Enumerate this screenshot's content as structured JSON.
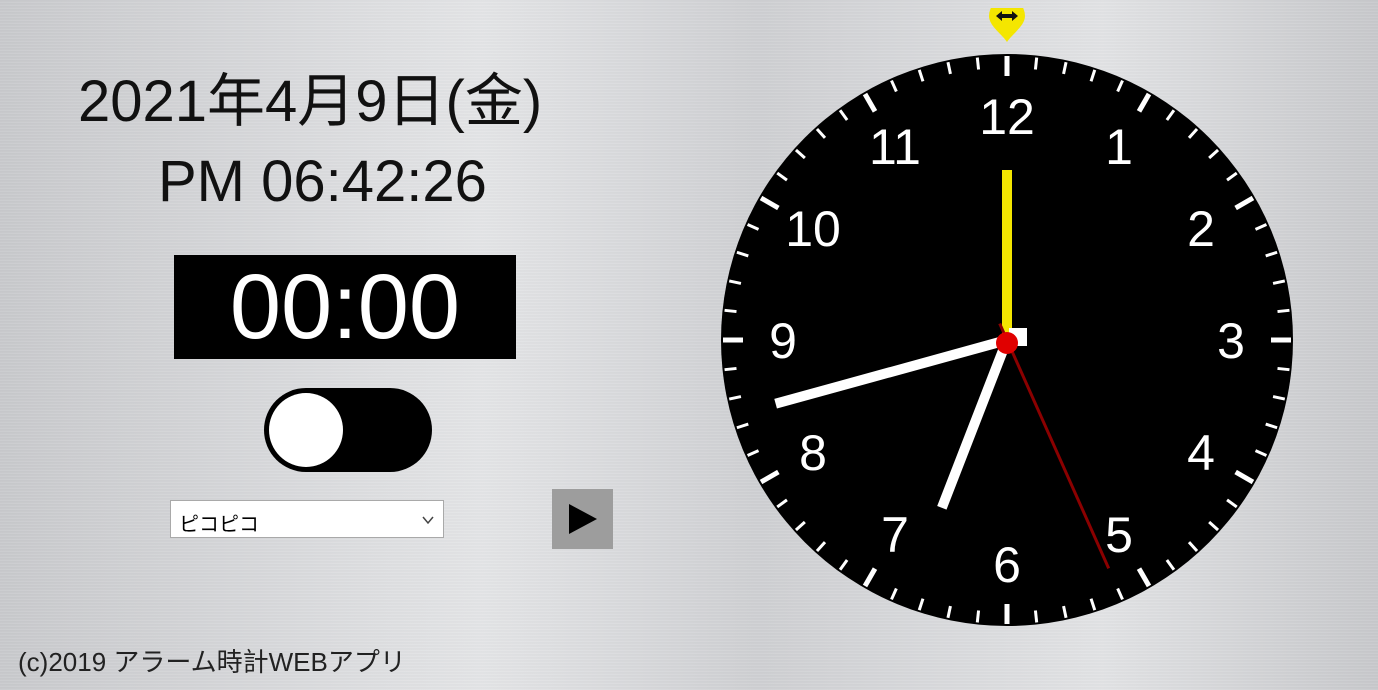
{
  "date": "2021年4月9日(金)",
  "time": "PM 06:42:26",
  "timer": "00:00",
  "alarm_toggle": {
    "state": "off"
  },
  "sound_select": {
    "value": "ピコピコ"
  },
  "play_button": {
    "icon": "play-icon"
  },
  "footer": "(c)2019 アラーム時計WEBアプリ",
  "clock": {
    "numerals": [
      "12",
      "1",
      "2",
      "3",
      "4",
      "5",
      "6",
      "7",
      "8",
      "9",
      "10",
      "11"
    ],
    "time": {
      "hour": 18,
      "minute": 42,
      "second": 26
    },
    "alarm_marker": {
      "icon": "resize-horizontal-icon",
      "minute": 0,
      "color": "#f4e600"
    },
    "colors": {
      "face": "#000000",
      "hands": "#ffffff",
      "second_hand": "#8b0000",
      "alarm_hand": "#f4e600",
      "center": "#e00000"
    }
  }
}
